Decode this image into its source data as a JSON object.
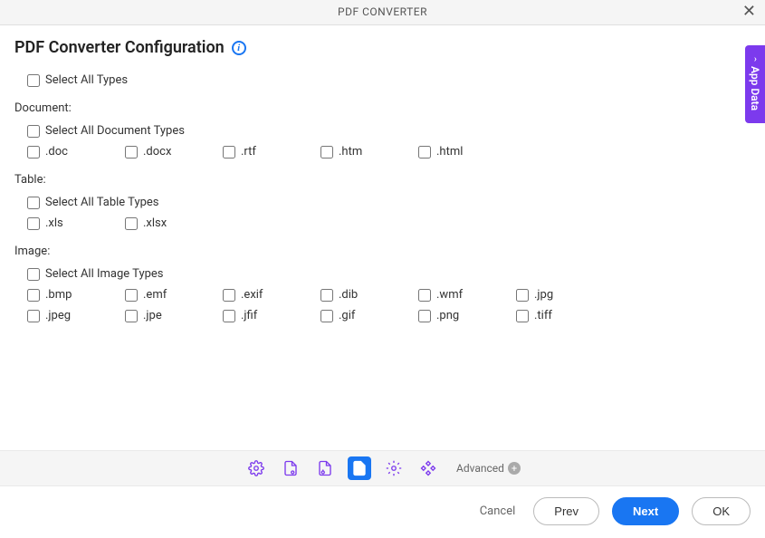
{
  "header": {
    "title": "PDF CONVERTER"
  },
  "page": {
    "title": "PDF Converter Configuration"
  },
  "global": {
    "select_all": "Select All Types"
  },
  "sections": {
    "document": {
      "label": "Document:",
      "select_all": "Select All Document Types",
      "types": [
        ".doc",
        ".docx",
        ".rtf",
        ".htm",
        ".html"
      ]
    },
    "table": {
      "label": "Table:",
      "select_all": "Select All Table Types",
      "types": [
        ".xls",
        ".xlsx"
      ]
    },
    "image": {
      "label": "Image:",
      "select_all": "Select All Image Types",
      "types": [
        ".bmp",
        ".emf",
        ".exif",
        ".dib",
        ".wmf",
        ".jpg",
        ".jpeg",
        ".jpe",
        ".jfif",
        ".gif",
        ".png",
        ".tiff"
      ]
    }
  },
  "side_tab": {
    "label": "App Data"
  },
  "toolbar": {
    "advanced": "Advanced"
  },
  "footer": {
    "cancel": "Cancel",
    "prev": "Prev",
    "next": "Next",
    "ok": "OK"
  }
}
